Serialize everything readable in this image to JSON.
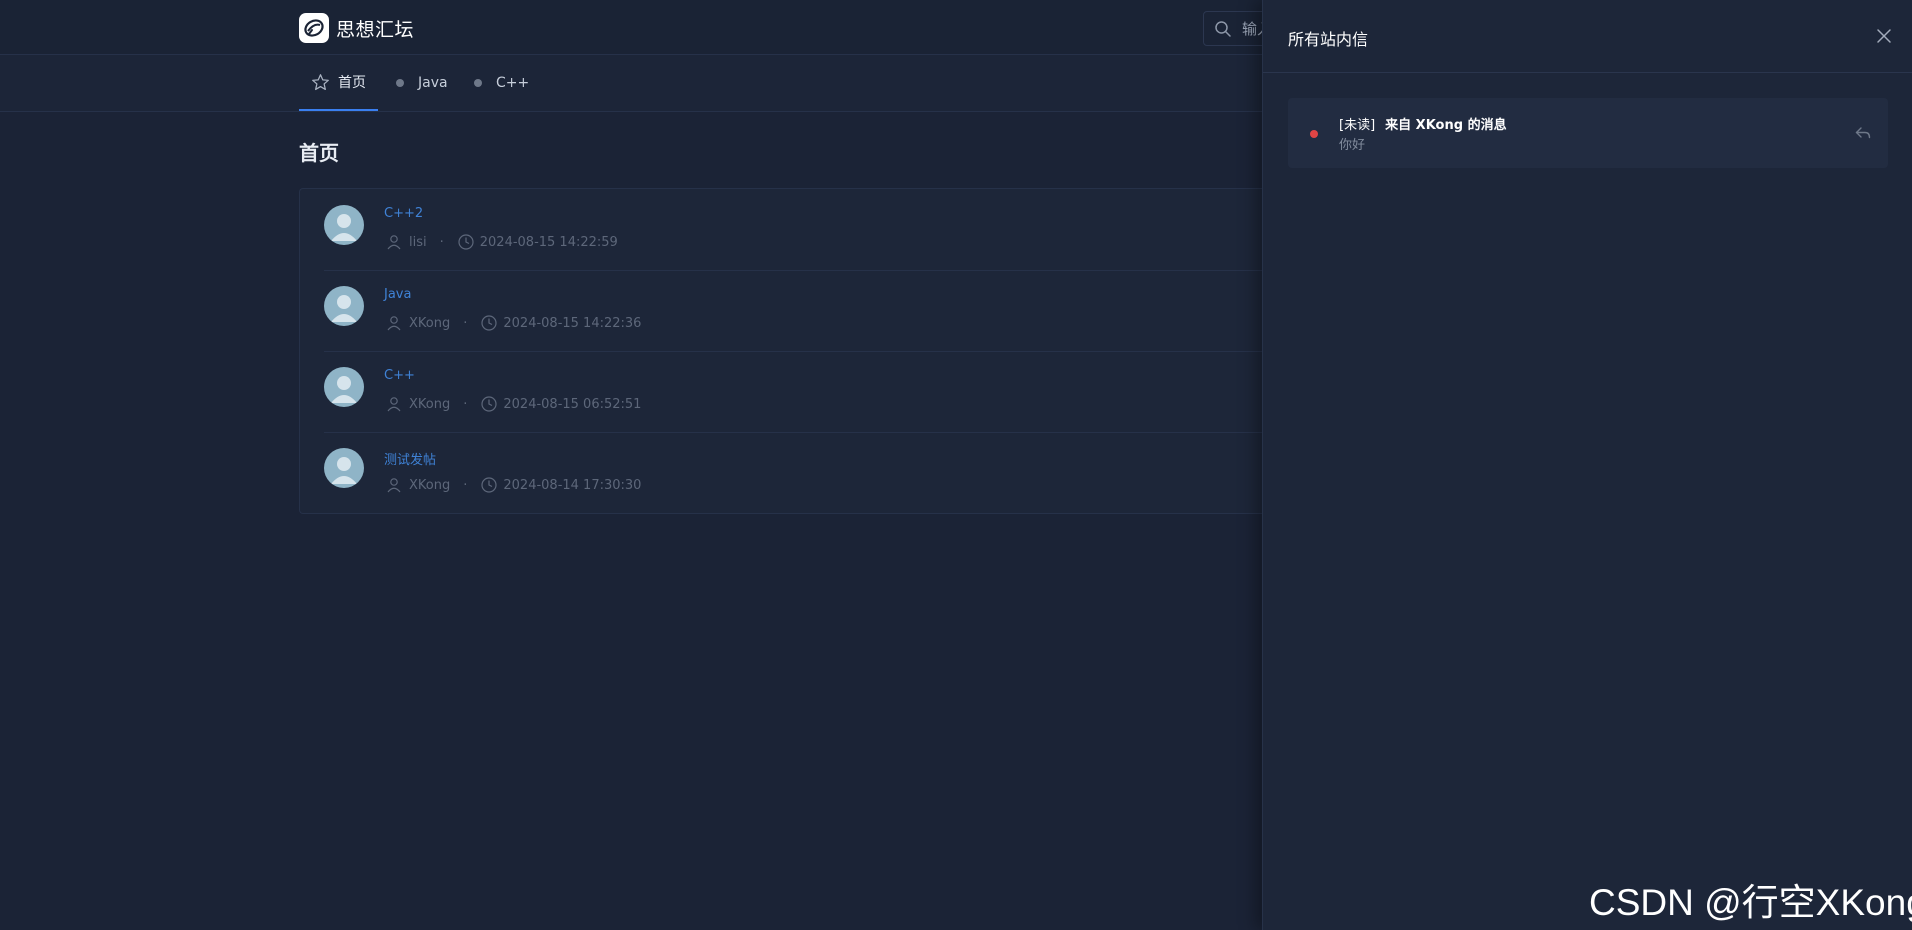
{
  "app": {
    "brand_name": "思想汇坛",
    "logo_icon": "leaf-chat-icon"
  },
  "search": {
    "placeholder": "输入关键字搜索",
    "icon": "search-icon"
  },
  "nav": {
    "tabs": [
      {
        "label": "首页",
        "icon": "star-icon",
        "active": true
      },
      {
        "label": "Java",
        "icon": "dot-icon",
        "active": false
      },
      {
        "label": "C++",
        "icon": "dot-icon",
        "active": false
      }
    ],
    "active_color": "#3a7ff0"
  },
  "main": {
    "page_title": "首页",
    "posts": [
      {
        "title": "C++2",
        "author": "lisi",
        "separator": "·",
        "time": "2024-08-15 14:22:59"
      },
      {
        "title": "Java",
        "author": "XKong",
        "separator": "·",
        "time": "2024-08-15 14:22:36"
      },
      {
        "title": "C++",
        "author": "XKong",
        "separator": "·",
        "time": "2024-08-15 06:52:51"
      },
      {
        "title": "测试发帖",
        "author": "XKong",
        "separator": "·",
        "time": "2024-08-14 17:30:30"
      }
    ],
    "title_color": "#3f82d6"
  },
  "drawer": {
    "title": "所有站内信",
    "close_icon": "close-icon",
    "messages": [
      {
        "status_tag": "[未读]",
        "title": "来自 XKong 的消息",
        "body": "你好",
        "unread": true,
        "unread_color": "#e04545",
        "reply_icon": "reply-icon"
      }
    ]
  },
  "watermark": {
    "text": "CSDN @行空XKong"
  }
}
